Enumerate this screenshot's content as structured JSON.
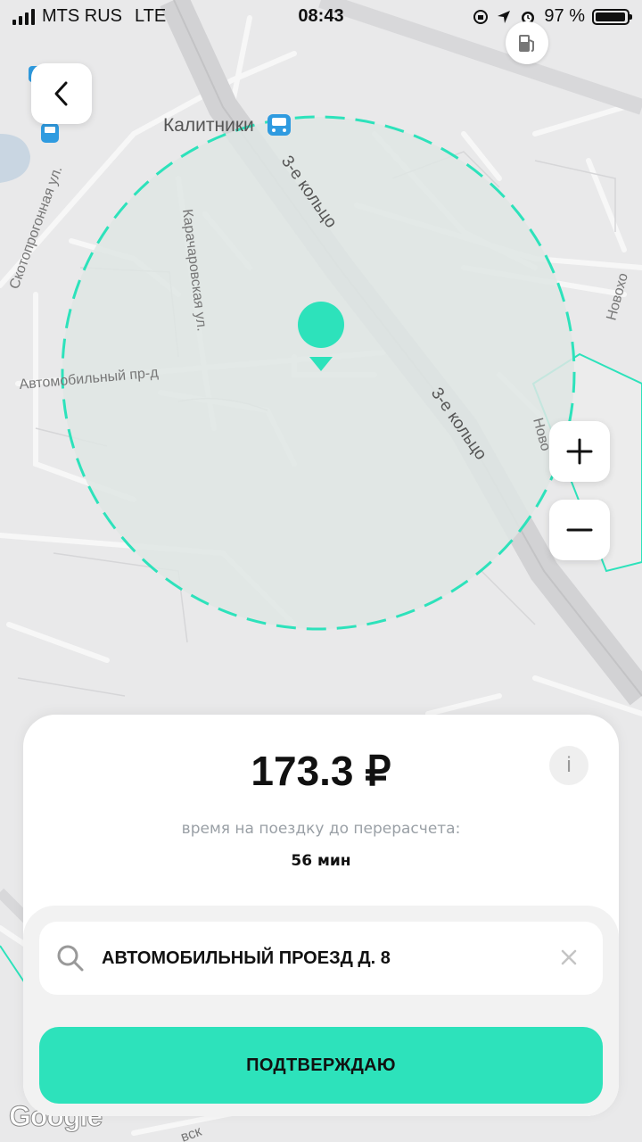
{
  "status_bar": {
    "carrier": "MTS RUS",
    "network": "LTE",
    "time": "08:43",
    "battery_percent_text": "97 %",
    "battery_level": 0.97
  },
  "map": {
    "place_label": "Калитники",
    "road_labels": [
      "3-е кольцо",
      "3-е кольцо",
      "Карачаровская ул.",
      "Скотопрогонная ул.",
      "Автомобильный пр-д",
      "Новохо",
      "Ново",
      "вск"
    ],
    "attribution": "Google"
  },
  "colors": {
    "accent": "#2de2bb",
    "circle_fill": "#dfe6e4",
    "map_background": "#e9e9ea"
  },
  "icons": {
    "back": "chevron-left-icon",
    "zoom_in": "plus-icon",
    "zoom_out": "minus-icon",
    "info": "info-icon",
    "search": "search-icon",
    "clear": "close-icon",
    "pin": "location-pin-icon",
    "fuel": "fuel-station-icon",
    "bus": "bus-stop-icon",
    "tram": "tram-icon"
  },
  "panel": {
    "price": "173.3 ₽",
    "info_label": "i",
    "subtitle": "время на поездку до перерасчета:",
    "duration": "56 мин"
  },
  "search": {
    "value": "АВТОМОБИЛЬНЫЙ ПРОЕЗД Д. 8"
  },
  "confirm_button": {
    "label": "ПОДТВЕРЖДАЮ"
  }
}
